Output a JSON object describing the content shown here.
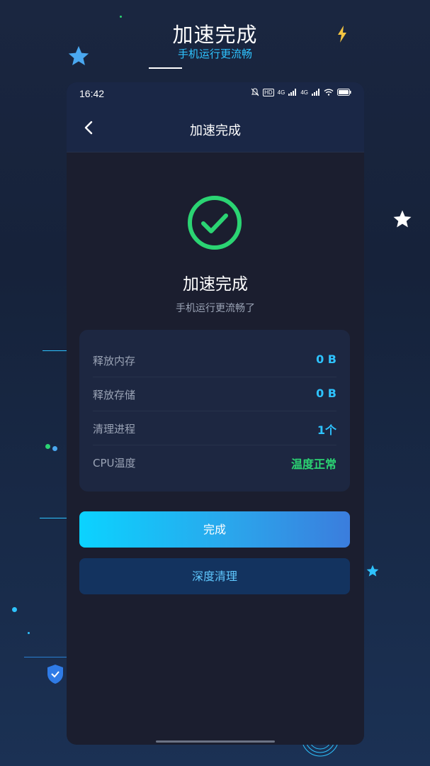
{
  "promo": {
    "title": "加速完成",
    "subtitle": "手机运行更流畅"
  },
  "status_bar": {
    "time": "16:42",
    "network_1": "4G",
    "network_2": "4G",
    "hd_badge": "HD"
  },
  "nav": {
    "back_icon": "chevron-left-icon",
    "title": "加速完成"
  },
  "result": {
    "icon": "check-circle-icon",
    "title": "加速完成",
    "subtitle": "手机运行更流畅了"
  },
  "stats": [
    {
      "label": "释放内存",
      "value": "0 B"
    },
    {
      "label": "释放存储",
      "value": "0 B"
    },
    {
      "label": "清理进程",
      "value": "1个"
    },
    {
      "label": "CPU温度",
      "value": "温度正常"
    }
  ],
  "buttons": {
    "done": "完成",
    "deep_clean": "深度清理"
  },
  "colors": {
    "accent": "#2ec3ff",
    "success": "#2bd473",
    "card": "#1d2741",
    "background": "#1b1e2f"
  }
}
